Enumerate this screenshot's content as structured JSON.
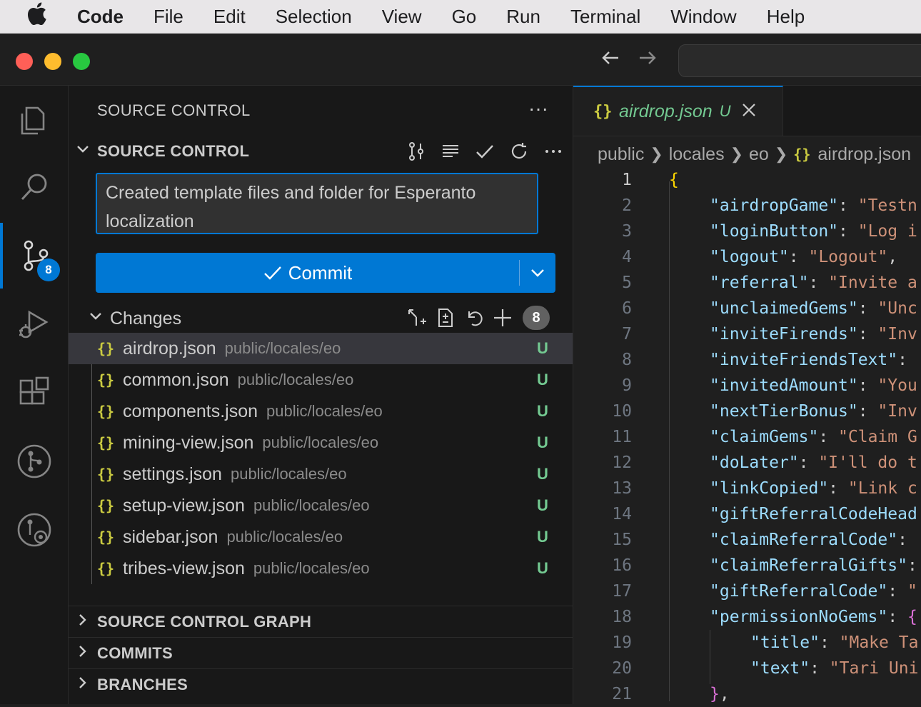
{
  "menubar": {
    "apple": "",
    "items": [
      "Code",
      "File",
      "Edit",
      "Selection",
      "View",
      "Go",
      "Run",
      "Terminal",
      "Window",
      "Help"
    ]
  },
  "titlebar": {
    "back_icon": "arrow-left-icon",
    "forward_icon": "arrow-right-icon"
  },
  "activitybar": {
    "source_control_badge": "8"
  },
  "sidebar": {
    "title": "SOURCE CONTROL",
    "section_title": "SOURCE CONTROL",
    "commit_message": "Created template files and folder for Esperanto localization",
    "commit_label": "Commit",
    "changes_label": "Changes",
    "changes_count": "8",
    "files": [
      {
        "name": "airdrop.json",
        "path": "public/locales/eo",
        "status": "U"
      },
      {
        "name": "common.json",
        "path": "public/locales/eo",
        "status": "U"
      },
      {
        "name": "components.json",
        "path": "public/locales/eo",
        "status": "U"
      },
      {
        "name": "mining-view.json",
        "path": "public/locales/eo",
        "status": "U"
      },
      {
        "name": "settings.json",
        "path": "public/locales/eo",
        "status": "U"
      },
      {
        "name": "setup-view.json",
        "path": "public/locales/eo",
        "status": "U"
      },
      {
        "name": "sidebar.json",
        "path": "public/locales/eo",
        "status": "U"
      },
      {
        "name": "tribes-view.json",
        "path": "public/locales/eo",
        "status": "U"
      }
    ],
    "bottom_sections": [
      "SOURCE CONTROL GRAPH",
      "COMMITS",
      "BRANCHES"
    ]
  },
  "editor": {
    "tab": {
      "name": "airdrop.json",
      "status": "U",
      "icon": "{}"
    },
    "breadcrumbs": [
      "public",
      "locales",
      "eo",
      "airdrop.json"
    ],
    "lines": [
      {
        "n": "1",
        "parts": [
          [
            "b",
            "{"
          ]
        ]
      },
      {
        "n": "2",
        "parts": [
          [
            "k",
            "\"airdropGame\""
          ],
          [
            "p",
            ": "
          ],
          [
            "s",
            "\"Testn"
          ]
        ]
      },
      {
        "n": "3",
        "parts": [
          [
            "k",
            "\"loginButton\""
          ],
          [
            "p",
            ": "
          ],
          [
            "s",
            "\"Log i"
          ]
        ]
      },
      {
        "n": "4",
        "parts": [
          [
            "k",
            "\"logout\""
          ],
          [
            "p",
            ": "
          ],
          [
            "s",
            "\"Logout\""
          ],
          [
            "p",
            ","
          ]
        ]
      },
      {
        "n": "5",
        "parts": [
          [
            "k",
            "\"referral\""
          ],
          [
            "p",
            ": "
          ],
          [
            "s",
            "\"Invite a"
          ]
        ]
      },
      {
        "n": "6",
        "parts": [
          [
            "k",
            "\"unclaimedGems\""
          ],
          [
            "p",
            ": "
          ],
          [
            "s",
            "\"Unc"
          ]
        ]
      },
      {
        "n": "7",
        "parts": [
          [
            "k",
            "\"inviteFirends\""
          ],
          [
            "p",
            ": "
          ],
          [
            "s",
            "\"Inv"
          ]
        ]
      },
      {
        "n": "8",
        "parts": [
          [
            "k",
            "\"inviteFriendsText\""
          ],
          [
            "p",
            ": "
          ]
        ]
      },
      {
        "n": "9",
        "parts": [
          [
            "k",
            "\"invitedAmount\""
          ],
          [
            "p",
            ": "
          ],
          [
            "s",
            "\"You"
          ]
        ]
      },
      {
        "n": "10",
        "parts": [
          [
            "k",
            "\"nextTierBonus\""
          ],
          [
            "p",
            ": "
          ],
          [
            "s",
            "\"Inv"
          ]
        ]
      },
      {
        "n": "11",
        "parts": [
          [
            "k",
            "\"claimGems\""
          ],
          [
            "p",
            ": "
          ],
          [
            "s",
            "\"Claim G"
          ]
        ]
      },
      {
        "n": "12",
        "parts": [
          [
            "k",
            "\"doLater\""
          ],
          [
            "p",
            ": "
          ],
          [
            "s",
            "\"I'll do t"
          ]
        ]
      },
      {
        "n": "13",
        "parts": [
          [
            "k",
            "\"linkCopied\""
          ],
          [
            "p",
            ": "
          ],
          [
            "s",
            "\"Link c"
          ]
        ]
      },
      {
        "n": "14",
        "parts": [
          [
            "k",
            "\"giftReferralCodeHead"
          ]
        ]
      },
      {
        "n": "15",
        "parts": [
          [
            "k",
            "\"claimReferralCode\""
          ],
          [
            "p",
            ": "
          ]
        ]
      },
      {
        "n": "16",
        "parts": [
          [
            "k",
            "\"claimReferralGifts\""
          ],
          [
            "p",
            ":"
          ]
        ]
      },
      {
        "n": "17",
        "parts": [
          [
            "k",
            "\"giftReferralCode\""
          ],
          [
            "p",
            ": "
          ],
          [
            "s",
            "\""
          ]
        ]
      },
      {
        "n": "18",
        "parts": [
          [
            "k",
            "\"permissionNoGems\""
          ],
          [
            "p",
            ": "
          ],
          [
            "b2",
            "{"
          ]
        ]
      },
      {
        "n": "19",
        "indent": 2,
        "parts": [
          [
            "k",
            "\"title\""
          ],
          [
            "p",
            ": "
          ],
          [
            "s",
            "\"Make Ta"
          ]
        ]
      },
      {
        "n": "20",
        "indent": 2,
        "parts": [
          [
            "k",
            "\"text\""
          ],
          [
            "p",
            ": "
          ],
          [
            "s",
            "\"Tari Uni"
          ]
        ]
      },
      {
        "n": "21",
        "parts": [
          [
            "b2",
            "}"
          ],
          [
            "p",
            ","
          ]
        ]
      }
    ]
  }
}
